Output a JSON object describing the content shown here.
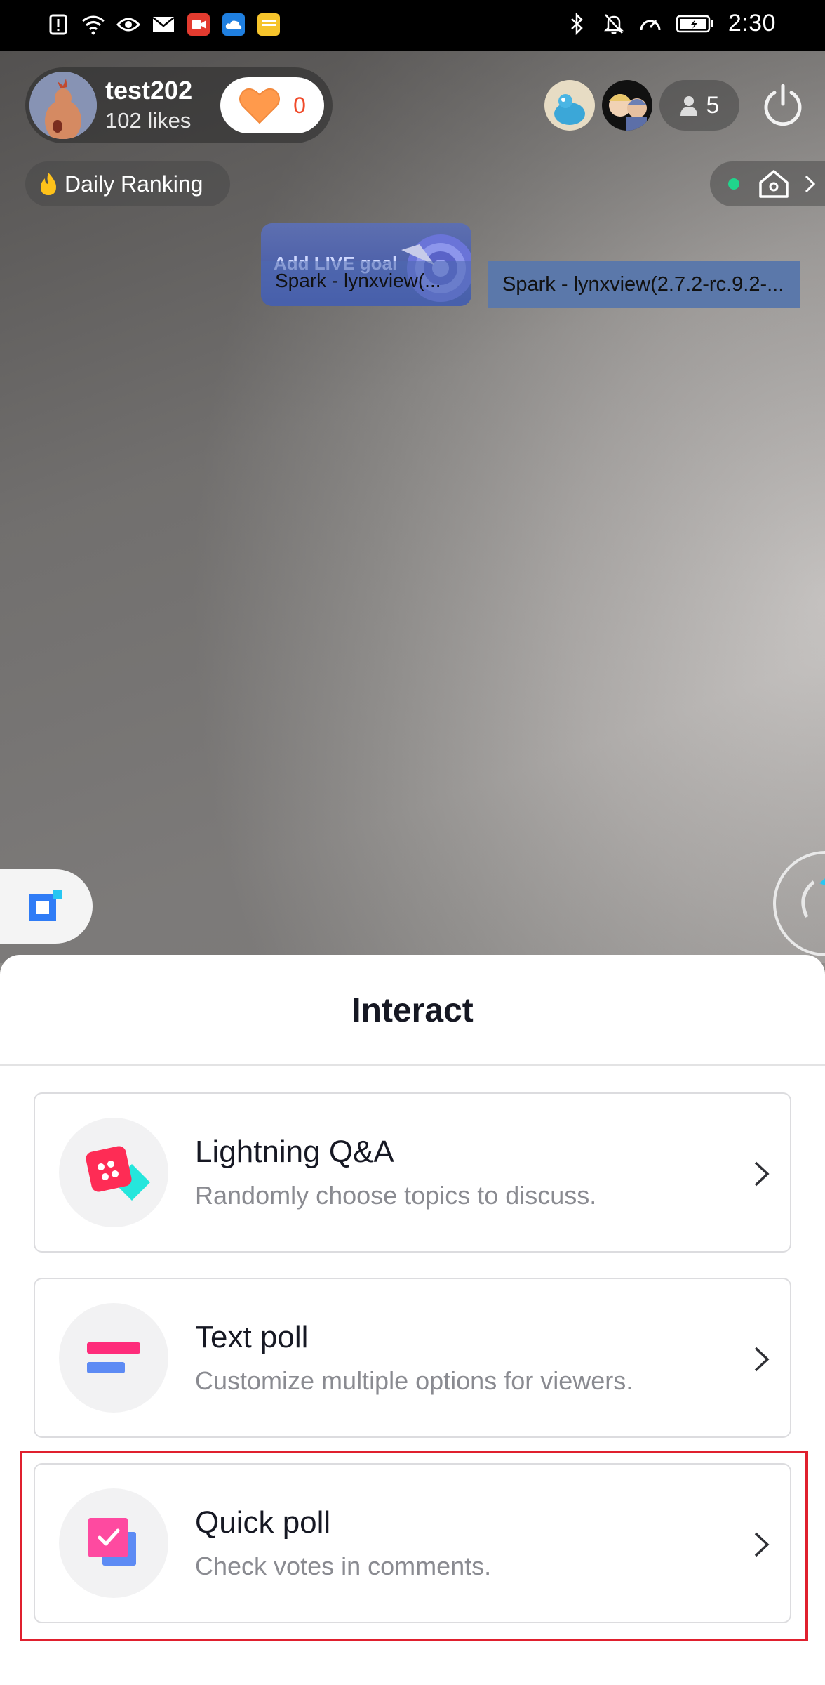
{
  "status_bar": {
    "time": "2:30",
    "left_icons": [
      "alert-icon",
      "wifi-icon",
      "eye-icon",
      "mail-icon",
      "video-app-icon",
      "cloud-app-icon",
      "notes-app-icon"
    ],
    "right_icons": [
      "bluetooth-icon",
      "mute-icon",
      "speed-icon",
      "battery-icon"
    ]
  },
  "live": {
    "host_name": "test202",
    "host_likes": "102 likes",
    "like_count": "0",
    "viewer_count": "5",
    "daily_ranking_label": "Daily Ranking",
    "goal_title": "Add LIVE goal",
    "goal_label": "Spark - lynxview(...",
    "spark_label": "Spark - lynxview(2.7.2-rc.9.2-..."
  },
  "sheet": {
    "title": "Interact",
    "options": [
      {
        "title": "Lightning Q&A",
        "subtitle": "Randomly choose topics to discuss.",
        "icon": "dice-icon"
      },
      {
        "title": "Text poll",
        "subtitle": "Customize multiple options for viewers.",
        "icon": "text-poll-icon"
      },
      {
        "title": "Quick poll",
        "subtitle": "Check votes in comments.",
        "icon": "quick-poll-icon"
      }
    ]
  },
  "colors": {
    "accent_red": "#e0202e",
    "pink": "#fe2c55",
    "cyan": "#25f4ee",
    "blue": "#5d8bf4"
  }
}
